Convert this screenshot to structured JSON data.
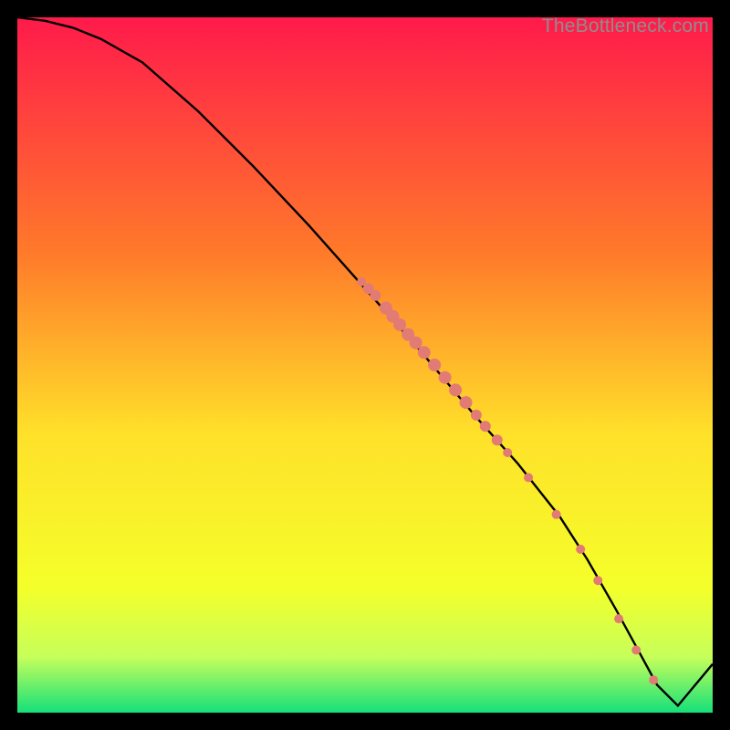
{
  "watermark": "TheBottleneck.com",
  "colors": {
    "gradient_top": "#ff1a4b",
    "gradient_mid1": "#ff7a2a",
    "gradient_mid2": "#ffe12a",
    "gradient_mid3": "#f4ff2a",
    "gradient_bottom": "#15e07a",
    "curve": "#000000",
    "dots": "#e27b74",
    "frame": "#000000"
  },
  "chart_data": {
    "type": "line",
    "title": "",
    "xlabel": "",
    "ylabel": "",
    "xlim": [
      0,
      100
    ],
    "ylim": [
      0,
      100
    ],
    "curve": {
      "x": [
        0,
        4,
        8,
        12,
        18,
        26,
        34,
        42,
        50,
        58,
        66,
        72,
        78,
        82,
        86,
        89,
        92,
        95,
        100
      ],
      "y": [
        100,
        99.5,
        98.5,
        96.9,
        93.5,
        86.5,
        78.5,
        70.0,
        61.0,
        52.0,
        42.5,
        35.8,
        28.2,
        22.0,
        15.0,
        9.5,
        4.0,
        1.0,
        7.0
      ]
    },
    "flat_segment": {
      "x_start": 86,
      "x_end": 95,
      "y": 1.0
    },
    "dots": [
      {
        "x": 49.5,
        "y": 62.0,
        "r": 5
      },
      {
        "x": 50.5,
        "y": 61.0,
        "r": 6
      },
      {
        "x": 51.5,
        "y": 60.0,
        "r": 6
      },
      {
        "x": 53.0,
        "y": 58.2,
        "r": 7
      },
      {
        "x": 54.0,
        "y": 57.0,
        "r": 7
      },
      {
        "x": 55.0,
        "y": 55.8,
        "r": 7
      },
      {
        "x": 56.2,
        "y": 54.4,
        "r": 7
      },
      {
        "x": 57.3,
        "y": 53.2,
        "r": 7
      },
      {
        "x": 58.5,
        "y": 51.8,
        "r": 7
      },
      {
        "x": 60.0,
        "y": 50.0,
        "r": 7
      },
      {
        "x": 61.5,
        "y": 48.2,
        "r": 7
      },
      {
        "x": 63.0,
        "y": 46.4,
        "r": 7
      },
      {
        "x": 64.5,
        "y": 44.6,
        "r": 7
      },
      {
        "x": 66.0,
        "y": 42.8,
        "r": 6
      },
      {
        "x": 67.3,
        "y": 41.2,
        "r": 6
      },
      {
        "x": 69.0,
        "y": 39.2,
        "r": 6
      },
      {
        "x": 70.5,
        "y": 37.4,
        "r": 5
      },
      {
        "x": 73.5,
        "y": 33.8,
        "r": 5
      },
      {
        "x": 77.5,
        "y": 28.5,
        "r": 5
      },
      {
        "x": 81.0,
        "y": 23.5,
        "r": 5
      },
      {
        "x": 83.5,
        "y": 19.0,
        "r": 5
      },
      {
        "x": 86.5,
        "y": 13.5,
        "r": 5
      },
      {
        "x": 89.0,
        "y": 9.0,
        "r": 5
      },
      {
        "x": 91.5,
        "y": 4.7,
        "r": 5
      }
    ]
  }
}
